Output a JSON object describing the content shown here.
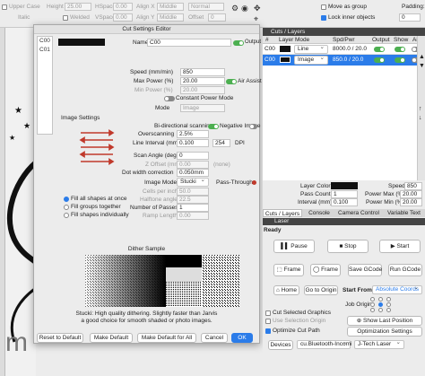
{
  "top_toolbar": {
    "upper_case": "Upper Case",
    "height_label": "Height",
    "height_value": "25.00",
    "hspace_label": "HSpace",
    "hspace_value": "0.00",
    "align_x_label": "Align X",
    "align_x_value": "Middle",
    "normal_value": "Normal",
    "welded": "Welded",
    "italic": "Italic",
    "vspace_label": "VSpace",
    "vspace_value": "0.00",
    "align_y_label": "Align Y",
    "align_y_value": "Middle",
    "offset_label": "Offset",
    "offset_value": "0",
    "move_as_group": "Move as group",
    "lock_inner_objects": "Lock inner objects",
    "padding_label": "Padding:",
    "padding_value": "0"
  },
  "dialog": {
    "title": "Cut Settings Editor",
    "layer_list": [
      "C00",
      "C01"
    ],
    "name_label": "Name",
    "name_value": "C00",
    "output_label": "Output",
    "speed_label": "Speed (mm/min)",
    "speed_value": "850",
    "max_power_label": "Max Power (%)",
    "max_power_value": "20.00",
    "air_assist_label": "Air Assist",
    "min_power_label": "Min Power (%)",
    "min_power_value": "20.00",
    "constant_power_label": "Constant Power Mode",
    "mode_label": "Mode",
    "mode_value": "Image",
    "image_settings_label": "Image Settings",
    "bidirectional_label": "Bi-directional scanning",
    "negative_image_label": "Negative Image",
    "overscanning_label": "Overscanning",
    "overscanning_value": "2.5%",
    "line_interval_label": "Line Interval (mm)",
    "line_interval_value": "0.100",
    "dpi_value": "254",
    "dpi_label": "DPI",
    "scan_angle_label": "Scan Angle (deg)",
    "scan_angle_value": "0",
    "z_offset_label": "Z Offset (mm)",
    "z_offset_value": "0.00",
    "none_label": "(none)",
    "dot_width_label": "Dot width correction",
    "dot_width_value": "0.050mm",
    "image_mode_label": "Image Mode",
    "image_mode_value": "Stucki",
    "pass_through_label": "Pass-Through",
    "cells_per_inch_label": "Cells per inch",
    "cells_per_inch_value": "50.0",
    "fill_all_label": "Fill all shapes at once",
    "halftone_angle_label": "Halftone angle",
    "halftone_angle_value": "22.5",
    "fill_groups_label": "Fill groups together",
    "num_passes_label": "Number of Passes",
    "num_passes_value": "1",
    "fill_individually_label": "Fill shapes individually",
    "ramp_length_label": "Ramp Length",
    "ramp_length_value": "0.00",
    "dither_title": "Dither Sample",
    "dither_desc_1": "Stucki: High quality dithering. Slightly faster than Jarvis",
    "dither_desc_2": "a good choice for smooth shaded or photo images.",
    "btn_reset": "Reset to Default",
    "btn_make_default": "Make Default",
    "btn_make_default_all": "Make Default for All",
    "btn_cancel": "Cancel",
    "btn_ok": "OK"
  },
  "cuts_panel": {
    "title": "Cuts / Layers",
    "columns": [
      "#",
      "Layer",
      "Mode",
      "Spd/Pwr",
      "Output",
      "Show",
      "Air"
    ],
    "rows": [
      {
        "num": "C00",
        "mode": "Line",
        "spdpwr": "8000.0 / 20.0"
      },
      {
        "num": "C00",
        "mode": "Image",
        "spdpwr": "850.0 / 20.0"
      }
    ],
    "layer_color_label": "Layer Color",
    "speed_label": "Speed",
    "speed_value": "850",
    "pass_count_label": "Pass Count",
    "pass_count_value": "1",
    "power_max_label": "Power Max (%)",
    "power_max_value": "20.00",
    "interval_label": "Interval (mm)",
    "interval_value": "0.100",
    "power_min_label": "Power Min (%)",
    "power_min_value": "20.00"
  },
  "tabs": [
    "Cuts / Layers",
    "Console",
    "Camera Control",
    "Variable Text"
  ],
  "laser_panel": {
    "title": "Laser",
    "status": "Ready",
    "pause": "Pause",
    "stop": "Stop",
    "start": "Start",
    "frame1": "Frame",
    "frame2": "Frame",
    "save_gcode": "Save GCode",
    "run_gcode": "Run GCode",
    "home": "Home",
    "go_to_origin": "Go to Origin",
    "start_from_label": "Start From:",
    "start_from_value": "Absolute Coords",
    "job_origin_label": "Job Origin",
    "cut_selected": "Cut Selected Graphics",
    "use_selection_origin": "Use Selection Origin",
    "show_last_position": "Show Last Position",
    "optimize_cut_path": "Optimize Cut Path",
    "optimization_settings": "Optimization Settings",
    "devices": "Devices",
    "port_value": "cu.Bluetooth-Incomi",
    "device_value": "J-Tech Laser"
  },
  "colors": {
    "dialog_bg": "#ececec",
    "canvas_bg": "#f1f1f1",
    "dark_panel": "#2f2f2f",
    "accent_blue": "#2b7ce9",
    "toggle_green": "#4caf50",
    "warn_red": "#c0392b"
  }
}
